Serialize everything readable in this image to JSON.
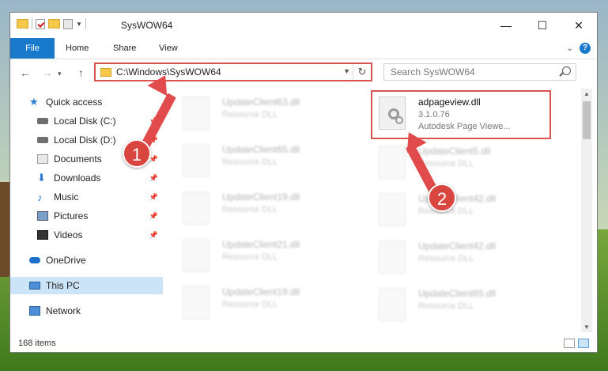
{
  "window": {
    "title": "SysWOW64",
    "controls": {
      "minimize": "—",
      "maximize": "☐",
      "close": "✕"
    }
  },
  "ribbon": {
    "tabs": [
      "File",
      "Home",
      "Share",
      "View"
    ]
  },
  "nav": {
    "back": "←",
    "forward": "→",
    "up": "↑",
    "address": "C:\\Windows\\SysWOW64",
    "refresh": "↻",
    "search_placeholder": "Search SysWOW64"
  },
  "sidebar": {
    "items": [
      {
        "label": "Quick access",
        "icon": "star-icon",
        "pinned": false
      },
      {
        "label": "Local Disk (C:)",
        "icon": "disk-icon",
        "pinned": true
      },
      {
        "label": "Local Disk (D:)",
        "icon": "disk-icon",
        "pinned": true
      },
      {
        "label": "Documents",
        "icon": "document-icon",
        "pinned": true
      },
      {
        "label": "Downloads",
        "icon": "download-icon",
        "pinned": true
      },
      {
        "label": "Music",
        "icon": "music-icon",
        "pinned": true
      },
      {
        "label": "Pictures",
        "icon": "pictures-icon",
        "pinned": true
      },
      {
        "label": "Videos",
        "icon": "videos-icon",
        "pinned": true
      },
      {
        "label": "OneDrive",
        "icon": "onedrive-icon",
        "pinned": false
      },
      {
        "label": "This PC",
        "icon": "computer-icon",
        "pinned": false,
        "selected": true
      },
      {
        "label": "Network",
        "icon": "network-icon",
        "pinned": false
      }
    ]
  },
  "files": {
    "highlighted": {
      "name": "adpageview.dll",
      "version": "3.1.0.76",
      "description": "Autodesk Page Viewe..."
    },
    "left_column": [
      {
        "name": "UpdateClient63.dll",
        "type": "Resource DLL"
      },
      {
        "name": "UpdateClient65.dll",
        "type": "Resource DLL"
      },
      {
        "name": "UpdateClient19.dll",
        "type": "Resource DLL"
      },
      {
        "name": "UpdateClient21.dll",
        "type": "Resource DLL"
      },
      {
        "name": "UpdateClient19.dll",
        "type": "Resource DLL"
      }
    ],
    "right_column": [
      {
        "name": "UpdateClient5.dll",
        "type": "Resource DLL"
      },
      {
        "name": "UpdateClient42.dll",
        "type": "Resource DLL"
      },
      {
        "name": "UpdateClient42.dll",
        "type": "Resource DLL"
      },
      {
        "name": "UpdateClient65.dll",
        "type": "Resource DLL"
      }
    ]
  },
  "status": {
    "item_count": "168 items"
  },
  "annotations": {
    "step1": "1",
    "step2": "2"
  },
  "colors": {
    "accent": "#1979ca",
    "highlight": "#d9534f",
    "selected_bg": "#cce4f7"
  }
}
